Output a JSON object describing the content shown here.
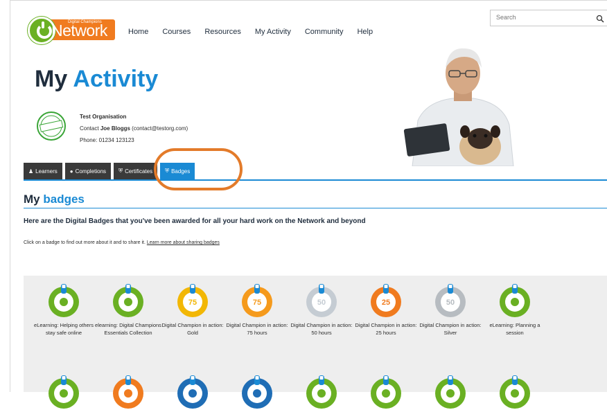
{
  "header": {
    "logo_small": "Digital Champions",
    "logo_text": "Network",
    "nav": [
      "Home",
      "Courses",
      "Resources",
      "My Activity",
      "Community",
      "Help"
    ],
    "search_placeholder": "Search"
  },
  "page": {
    "title_part1": "My",
    "title_part2": "Activity"
  },
  "organisation": {
    "name": "Test Organisation",
    "contact_prefix": "Contact",
    "contact_name": "Joe Bloggs",
    "contact_email": "(contact@testorg.com)",
    "phone": "Phone: 01234 123123",
    "stamp_text": "TESTING"
  },
  "tabs": [
    {
      "label": "Learners",
      "icon": "user-icon"
    },
    {
      "label": "Completions",
      "icon": "circle-icon"
    },
    {
      "label": "Certificates",
      "icon": "shield-icon"
    },
    {
      "label": "Badges",
      "icon": "shield-icon",
      "active": true
    }
  ],
  "badges_section": {
    "title_part1": "My",
    "title_part2": "badges",
    "intro": "Here are the Digital Badges that you've been awarded for all your hard work on the Network and beyond",
    "hint": "Click on a badge to find out more about it and to share it.",
    "hint_link": "Learn more about sharing badges"
  },
  "badges": [
    {
      "label": "eLearning: Helping others stay safe online",
      "color": "#6ab023",
      "number": "",
      "icon": "shield-heart-icon"
    },
    {
      "label": "elearning: Digital Champions Essentials Collection",
      "color": "#6ab023",
      "number": "",
      "icon": "trophy-icon"
    },
    {
      "label": "Digital Champion in action: Gold",
      "color": "#f2b705",
      "number": "75",
      "icon": "ribbon-icon"
    },
    {
      "label": "Digital Champion in action: 75 hours",
      "color": "#f59a1c",
      "number": "75",
      "icon": "clock-icon"
    },
    {
      "label": "Digital Champion in action: 50 hours",
      "color": "#c5ccd3",
      "number": "50",
      "icon": "clock-icon"
    },
    {
      "label": "Digital Champion in action: 25 hours",
      "color": "#f07b1f",
      "number": "25",
      "icon": "clock-icon"
    },
    {
      "label": "Digital Champion in action: Silver",
      "color": "#b7bcc1",
      "number": "50",
      "icon": "ribbon-icon"
    },
    {
      "label": "eLearning: Planning a session",
      "color": "#6ab023",
      "number": "",
      "icon": "checklist-icon"
    }
  ],
  "next_row_colors": [
    "#6ab023",
    "#f07b1f",
    "#1f6db5",
    "#1f6db5",
    "#6ab023",
    "#6ab023",
    "#6ab023",
    "#6ab023"
  ]
}
